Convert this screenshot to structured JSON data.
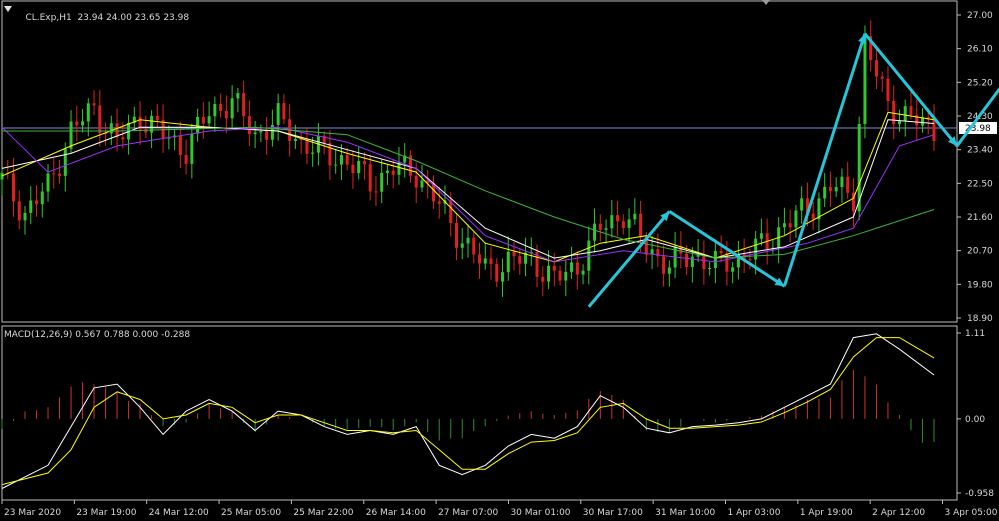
{
  "header": {
    "symbol": "CL.Exp,H1",
    "ohlc": "23.94 24.00 23.65 23.98"
  },
  "macd_header": {
    "label": "MACD(12,26,9) 0.567 0.788 0.000 -0.288"
  },
  "price_axis": {
    "ticks": [
      "27.00",
      "26.10",
      "25.20",
      "24.30",
      "23.40",
      "22.50",
      "21.60",
      "20.70",
      "19.80",
      "18.90"
    ],
    "current_price": "23.98"
  },
  "macd_axis": {
    "ticks": [
      "1.11",
      "0.00",
      "-0.958"
    ]
  },
  "time_axis": {
    "labels": [
      "23 Mar 2020",
      "23 Mar 19:00",
      "24 Mar 12:00",
      "25 Mar 05:00",
      "25 Mar 22:00",
      "26 Mar 14:00",
      "27 Mar 07:00",
      "30 Mar 01:00",
      "30 Mar 17:00",
      "31 Mar 10:00",
      "1 Apr 03:00",
      "1 Apr 19:00",
      "2 Apr 12:00",
      "3 Apr 05:00"
    ]
  },
  "colors": {
    "background": "#000000",
    "bull_candle": "#2fc82f",
    "bear_candle": "#e02020",
    "ma_fast": "#ffff00",
    "ma_white": "#ffffff",
    "ma_purple": "#9b30ff",
    "ma_green": "#3cb43c",
    "arrow": "#26c6da",
    "hist_pos": "#d03030",
    "hist_neg": "#2e8b2e",
    "price_line": "#7a8fd0"
  },
  "chart_data": [
    {
      "type": "candlestick",
      "title": "CL.Exp,H1",
      "ylim": [
        18.9,
        27.0
      ],
      "current_price": 23.98,
      "close_path": [
        [
          0,
          22.6
        ],
        [
          4,
          21.7
        ],
        [
          8,
          22.4
        ],
        [
          12,
          23.9
        ],
        [
          16,
          24.5
        ],
        [
          20,
          23.6
        ],
        [
          24,
          24.3
        ],
        [
          28,
          23.8
        ],
        [
          32,
          23.4
        ],
        [
          36,
          24.4
        ],
        [
          40,
          24.7
        ],
        [
          44,
          23.8
        ],
        [
          48,
          24.2
        ],
        [
          52,
          23.6
        ],
        [
          56,
          23.3
        ],
        [
          60,
          23.1
        ],
        [
          64,
          22.5
        ],
        [
          68,
          22.9
        ],
        [
          72,
          22.8
        ],
        [
          76,
          21.9
        ],
        [
          80,
          21.0
        ],
        [
          84,
          20.2
        ],
        [
          88,
          20.4
        ],
        [
          92,
          20.5
        ],
        [
          96,
          19.9
        ],
        [
          100,
          20.3
        ],
        [
          104,
          21.3
        ],
        [
          108,
          21.7
        ],
        [
          112,
          20.8
        ],
        [
          116,
          20.3
        ],
        [
          120,
          20.6
        ],
        [
          124,
          20.3
        ],
        [
          128,
          20.5
        ],
        [
          132,
          20.8
        ],
        [
          136,
          21.4
        ],
        [
          140,
          21.8
        ],
        [
          144,
          22.4
        ],
        [
          148,
          22.2
        ],
        [
          150,
          26.2
        ],
        [
          154,
          24.6
        ],
        [
          158,
          24.2
        ],
        [
          162,
          23.98
        ]
      ],
      "moving_averages": [
        {
          "color": "yellow",
          "path": [
            [
              0,
              22.7
            ],
            [
              12,
              23.5
            ],
            [
              24,
              24.2
            ],
            [
              36,
              24.0
            ],
            [
              48,
              23.9
            ],
            [
              60,
              23.3
            ],
            [
              72,
              22.8
            ],
            [
              84,
              20.9
            ],
            [
              96,
              20.4
            ],
            [
              104,
              20.9
            ],
            [
              112,
              21.1
            ],
            [
              124,
              20.5
            ],
            [
              136,
              21.1
            ],
            [
              148,
              22.1
            ],
            [
              154,
              24.4
            ],
            [
              162,
              24.2
            ]
          ]
        },
        {
          "color": "white",
          "path": [
            [
              0,
              22.9
            ],
            [
              12,
              23.3
            ],
            [
              24,
              24.0
            ],
            [
              36,
              24.0
            ],
            [
              48,
              23.9
            ],
            [
              60,
              23.4
            ],
            [
              72,
              22.9
            ],
            [
              84,
              21.3
            ],
            [
              96,
              20.5
            ],
            [
              104,
              20.7
            ],
            [
              112,
              21.0
            ],
            [
              124,
              20.5
            ],
            [
              136,
              20.8
            ],
            [
              148,
              21.6
            ],
            [
              154,
              24.2
            ],
            [
              162,
              24.1
            ]
          ]
        },
        {
          "color": "purple",
          "path": [
            [
              0,
              24.0
            ],
            [
              8,
              22.8
            ],
            [
              20,
              23.5
            ],
            [
              36,
              23.9
            ],
            [
              48,
              24.0
            ],
            [
              60,
              23.6
            ],
            [
              72,
              22.9
            ],
            [
              84,
              21.1
            ],
            [
              96,
              20.4
            ],
            [
              108,
              20.7
            ],
            [
              124,
              20.4
            ],
            [
              140,
              20.9
            ],
            [
              148,
              21.3
            ],
            [
              156,
              23.5
            ],
            [
              162,
              23.8
            ]
          ]
        },
        {
          "color": "green",
          "path": [
            [
              0,
              23.9
            ],
            [
              20,
              23.9
            ],
            [
              44,
              24.0
            ],
            [
              60,
              23.8
            ],
            [
              72,
              23.1
            ],
            [
              84,
              22.3
            ],
            [
              96,
              21.6
            ],
            [
              108,
              21.0
            ],
            [
              124,
              20.5
            ],
            [
              136,
              20.6
            ],
            [
              148,
              21.1
            ],
            [
              162,
              21.8
            ]
          ]
        }
      ],
      "annotations": [
        {
          "type": "arrow",
          "from": [
            102,
            19.2
          ],
          "to": [
            116,
            21.75
          ]
        },
        {
          "type": "arrow",
          "from": [
            116,
            21.75
          ],
          "to": [
            136,
            19.75
          ]
        },
        {
          "type": "arrow",
          "from": [
            136,
            19.75
          ],
          "to": [
            150,
            26.5
          ]
        },
        {
          "type": "arrow",
          "from": [
            150,
            26.5
          ],
          "to": [
            166,
            23.5
          ]
        },
        {
          "type": "arrow",
          "from": [
            166,
            23.5
          ],
          "to": [
            182,
            26.8
          ]
        }
      ]
    },
    {
      "type": "bar",
      "title": "MACD(12,26,9)",
      "ylim": [
        -0.958,
        1.11
      ],
      "histogram": [
        [
          0,
          -0.15
        ],
        [
          4,
          0.1
        ],
        [
          8,
          0.15
        ],
        [
          12,
          0.45
        ],
        [
          16,
          0.5
        ],
        [
          20,
          0.35
        ],
        [
          24,
          0.2
        ],
        [
          28,
          -0.1
        ],
        [
          32,
          -0.05
        ],
        [
          36,
          0.2
        ],
        [
          40,
          0.1
        ],
        [
          44,
          -0.2
        ],
        [
          48,
          0.05
        ],
        [
          52,
          0.0
        ],
        [
          56,
          -0.1
        ],
        [
          60,
          -0.15
        ],
        [
          64,
          -0.1
        ],
        [
          68,
          -0.15
        ],
        [
          72,
          -0.05
        ],
        [
          76,
          -0.3
        ],
        [
          80,
          -0.25
        ],
        [
          84,
          -0.1
        ],
        [
          88,
          0.05
        ],
        [
          92,
          0.1
        ],
        [
          96,
          0.05
        ],
        [
          100,
          0.12
        ],
        [
          104,
          0.4
        ],
        [
          108,
          0.25
        ],
        [
          112,
          -0.15
        ],
        [
          116,
          -0.2
        ],
        [
          120,
          0.0
        ],
        [
          124,
          -0.05
        ],
        [
          128,
          0.0
        ],
        [
          132,
          0.05
        ],
        [
          136,
          0.15
        ],
        [
          140,
          0.25
        ],
        [
          144,
          0.3
        ],
        [
          148,
          0.7
        ],
        [
          152,
          0.45
        ],
        [
          156,
          0.05
        ],
        [
          160,
          -0.35
        ],
        [
          162,
          -0.3
        ]
      ],
      "macd_line": [
        [
          0,
          -0.9
        ],
        [
          8,
          -0.6
        ],
        [
          12,
          -0.1
        ],
        [
          16,
          0.4
        ],
        [
          20,
          0.45
        ],
        [
          24,
          0.15
        ],
        [
          28,
          -0.2
        ],
        [
          32,
          0.1
        ],
        [
          36,
          0.25
        ],
        [
          40,
          0.1
        ],
        [
          44,
          -0.15
        ],
        [
          48,
          0.1
        ],
        [
          52,
          0.05
        ],
        [
          56,
          -0.1
        ],
        [
          60,
          -0.2
        ],
        [
          64,
          -0.15
        ],
        [
          68,
          -0.2
        ],
        [
          72,
          -0.1
        ],
        [
          76,
          -0.6
        ],
        [
          80,
          -0.72
        ],
        [
          84,
          -0.6
        ],
        [
          88,
          -0.35
        ],
        [
          92,
          -0.2
        ],
        [
          96,
          -0.25
        ],
        [
          100,
          -0.1
        ],
        [
          104,
          0.3
        ],
        [
          108,
          0.15
        ],
        [
          112,
          -0.12
        ],
        [
          116,
          -0.18
        ],
        [
          120,
          -0.1
        ],
        [
          124,
          -0.08
        ],
        [
          128,
          -0.05
        ],
        [
          132,
          0.0
        ],
        [
          136,
          0.15
        ],
        [
          140,
          0.3
        ],
        [
          144,
          0.45
        ],
        [
          148,
          1.05
        ],
        [
          152,
          1.1
        ],
        [
          156,
          0.9
        ],
        [
          162,
          0.567
        ]
      ],
      "signal_line": [
        [
          0,
          -0.85
        ],
        [
          8,
          -0.7
        ],
        [
          12,
          -0.4
        ],
        [
          16,
          0.15
        ],
        [
          20,
          0.35
        ],
        [
          24,
          0.25
        ],
        [
          28,
          0.0
        ],
        [
          32,
          0.05
        ],
        [
          36,
          0.2
        ],
        [
          40,
          0.15
        ],
        [
          44,
          -0.05
        ],
        [
          48,
          0.05
        ],
        [
          52,
          0.05
        ],
        [
          56,
          -0.05
        ],
        [
          60,
          -0.15
        ],
        [
          64,
          -0.15
        ],
        [
          68,
          -0.18
        ],
        [
          72,
          -0.15
        ],
        [
          76,
          -0.4
        ],
        [
          80,
          -0.65
        ],
        [
          84,
          -0.65
        ],
        [
          88,
          -0.45
        ],
        [
          92,
          -0.3
        ],
        [
          96,
          -0.28
        ],
        [
          100,
          -0.18
        ],
        [
          104,
          0.15
        ],
        [
          108,
          0.2
        ],
        [
          112,
          0.0
        ],
        [
          116,
          -0.12
        ],
        [
          120,
          -0.12
        ],
        [
          124,
          -0.1
        ],
        [
          128,
          -0.08
        ],
        [
          132,
          -0.04
        ],
        [
          136,
          0.08
        ],
        [
          140,
          0.22
        ],
        [
          144,
          0.38
        ],
        [
          148,
          0.8
        ],
        [
          152,
          1.05
        ],
        [
          156,
          1.05
        ],
        [
          162,
          0.788
        ]
      ]
    }
  ]
}
